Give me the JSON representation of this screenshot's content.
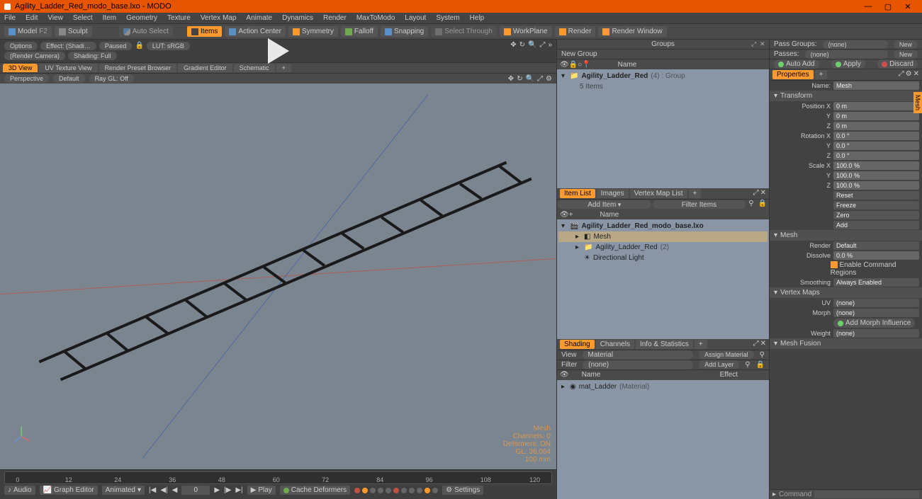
{
  "titlebar": {
    "title": "Agility_Ladder_Red_modo_base.lxo - MODO"
  },
  "menu": [
    "File",
    "Edit",
    "View",
    "Select",
    "Item",
    "Geometry",
    "Texture",
    "Vertex Map",
    "Animate",
    "Dynamics",
    "Render",
    "MaxToModo",
    "Layout",
    "System",
    "Help"
  ],
  "toolbar": {
    "model": "Model",
    "model_key": "F2",
    "sculpt": "Sculpt",
    "autoselect": "Auto Select",
    "items": "Items",
    "action_center": "Action Center",
    "symmetry": "Symmetry",
    "falloff": "Falloff",
    "snapping": "Snapping",
    "select_through": "Select Through",
    "workplane": "WorkPlane",
    "render": "Render",
    "render_window": "Render Window"
  },
  "renderbar": {
    "options": "Options",
    "effect": "Effect: (Shadi…",
    "paused": "Paused",
    "lut": "LUT: sRGB",
    "camera": "(Render Camera)",
    "shading": "Shading: Full"
  },
  "viewtabs": [
    "3D View",
    "UV Texture View",
    "Render Preset Browser",
    "Gradient Editor",
    "Schematic"
  ],
  "viewbar": {
    "persp": "Perspective",
    "default": "Default",
    "raygl": "Ray GL: Off"
  },
  "vpinfo": {
    "mesh": "Mesh",
    "channels": "Channels: 0",
    "deformers": "Deformers: ON",
    "gl": "GL: 36,064",
    "unit": "100 mm"
  },
  "timeline": {
    "ticks": [
      "0",
      "12",
      "24",
      "36",
      "48",
      "60",
      "72",
      "84",
      "96",
      "108",
      "120"
    ],
    "audio": "Audio",
    "graph": "Graph Editor",
    "animated": "Animated",
    "frame": "0",
    "play": "Play",
    "cache": "Cache Deformers",
    "settings": "Settings"
  },
  "groups": {
    "title": "Groups",
    "newgroup": "New Group",
    "name_col": "Name",
    "item": "Agility_Ladder_Red",
    "item_meta": "(4) : Group",
    "sub": "5 Items"
  },
  "passrow": {
    "passgroups": "Pass Groups:",
    "passes": "Passes:",
    "none": "(none)",
    "new": "New"
  },
  "applyrow": {
    "autoadd": "Auto Add",
    "apply": "Apply",
    "discard": "Discard"
  },
  "itemlist": {
    "tabs": [
      "Item List",
      "Images",
      "Vertex Map List"
    ],
    "additem": "Add Item",
    "filter": "Filter Items",
    "name_col": "Name",
    "scene": "Agility_Ladder_Red_modo_base.lxo",
    "mesh": "Mesh",
    "group": "Agility_Ladder_Red",
    "group_meta": "(2)",
    "light": "Directional Light"
  },
  "shading": {
    "tabs": [
      "Shading",
      "Channels",
      "Info & Statistics"
    ],
    "view": "View",
    "material": "Material",
    "assign": "Assign Material",
    "filter": "Filter",
    "none": "(none)",
    "addlayer": "Add Layer",
    "name_col": "Name",
    "effect_col": "Effect",
    "mat": "mat_Ladder",
    "mat_meta": "(Material)"
  },
  "props": {
    "title": "Properties",
    "name_lbl": "Name:",
    "name_val": "Mesh",
    "transform": "Transform",
    "posx_lbl": "Position X",
    "posy_lbl": "Y",
    "posz_lbl": "Z",
    "pos_val": "0 m",
    "rotx_lbl": "Rotation X",
    "roty_lbl": "Y",
    "rotz_lbl": "Z",
    "rot_val": "0.0 °",
    "sclx_lbl": "Scale X",
    "scly_lbl": "Y",
    "sclz_lbl": "Z",
    "scl_val": "100.0 %",
    "reset": "Reset",
    "freeze": "Freeze",
    "zero": "Zero",
    "add": "Add",
    "mesh_hdr": "Mesh",
    "render_lbl": "Render",
    "render_val": "Default",
    "dissolve_lbl": "Dissolve",
    "dissolve_val": "0.0 %",
    "enable_cmd": "Enable Command Regions",
    "smoothing_lbl": "Smoothing",
    "smoothing_val": "Always Enabled",
    "vmaps_hdr": "Vertex Maps",
    "uv_lbl": "UV",
    "morph_lbl": "Morph",
    "weight_lbl": "Weight",
    "none": "(none)",
    "add_morph": "Add Morph Influence",
    "fusion_hdr": "Mesh Fusion",
    "side_tab": "Mesh"
  },
  "cmdbar": {
    "label": "Command"
  }
}
